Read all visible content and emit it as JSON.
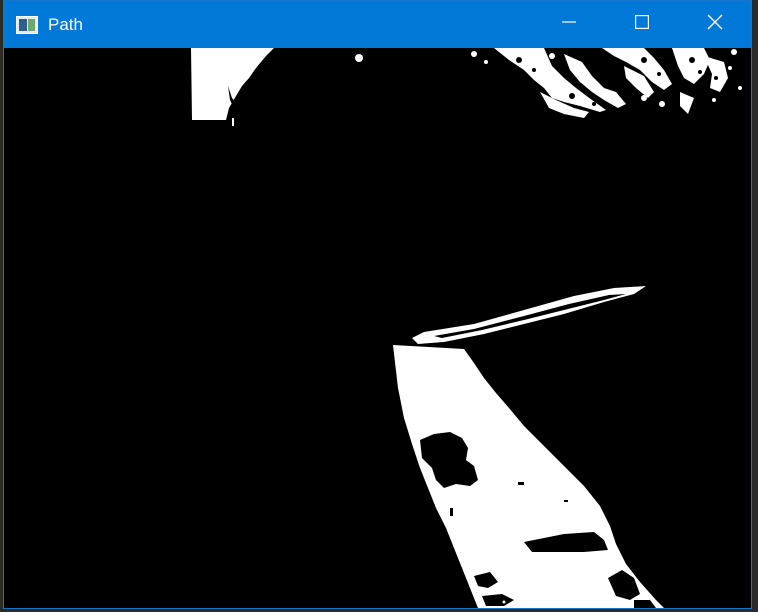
{
  "window": {
    "title": "Path",
    "icon": "image-window-icon",
    "controls": [
      {
        "name": "minimize",
        "icon": "minimize-icon"
      },
      {
        "name": "maximize",
        "icon": "maximize-icon"
      },
      {
        "name": "close",
        "icon": "close-icon"
      }
    ]
  },
  "colors": {
    "titlebar": "#0078d7",
    "title_text": "#ffffff",
    "image_background": "#000000",
    "image_foreground": "#ffffff"
  }
}
